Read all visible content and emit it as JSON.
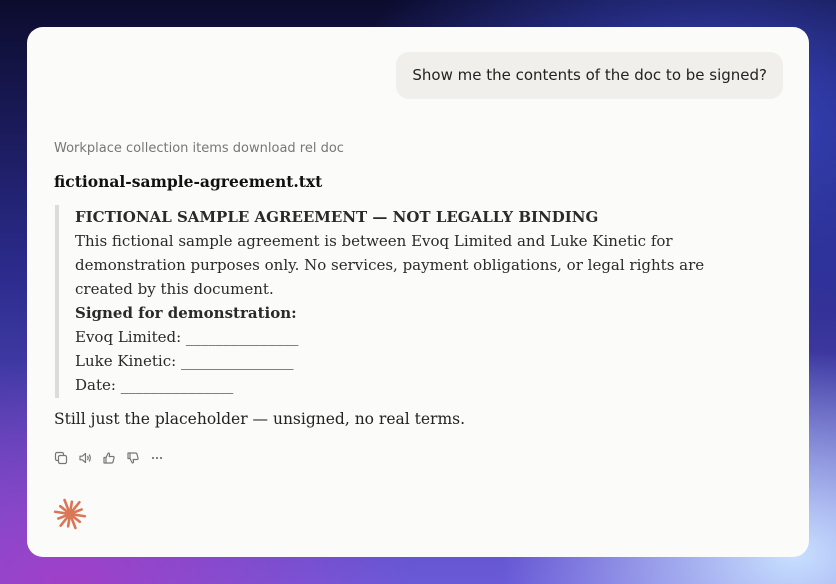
{
  "user_message": "Show me the contents of the doc to be signed?",
  "source_label": "Workplace collection items download rel doc",
  "document": {
    "file_name": "fictional-sample-agreement.txt",
    "heading": "FICTIONAL SAMPLE AGREEMENT — NOT LEGALLY BINDING",
    "body_lines": [
      "This fictional sample agreement is between Evoq Limited and Luke Kinetic for",
      "demonstration purposes only. No services, payment obligations, or legal rights are",
      "created by this document."
    ],
    "signed_label": "Signed for demonstration:",
    "signature_lines": [
      "Evoq Limited: _______________",
      "Luke Kinetic: _______________",
      "Date: _______________"
    ]
  },
  "assistant_reply": "Still just the placeholder — unsigned, no real terms.",
  "action_icons": [
    "copy-icon",
    "speaker-icon",
    "thumbs-up-icon",
    "thumbs-down-icon",
    "more-icon"
  ],
  "colors": {
    "logo": "#d97757",
    "card": "#fbfbf9",
    "user_bubble": "#f0efeb"
  }
}
